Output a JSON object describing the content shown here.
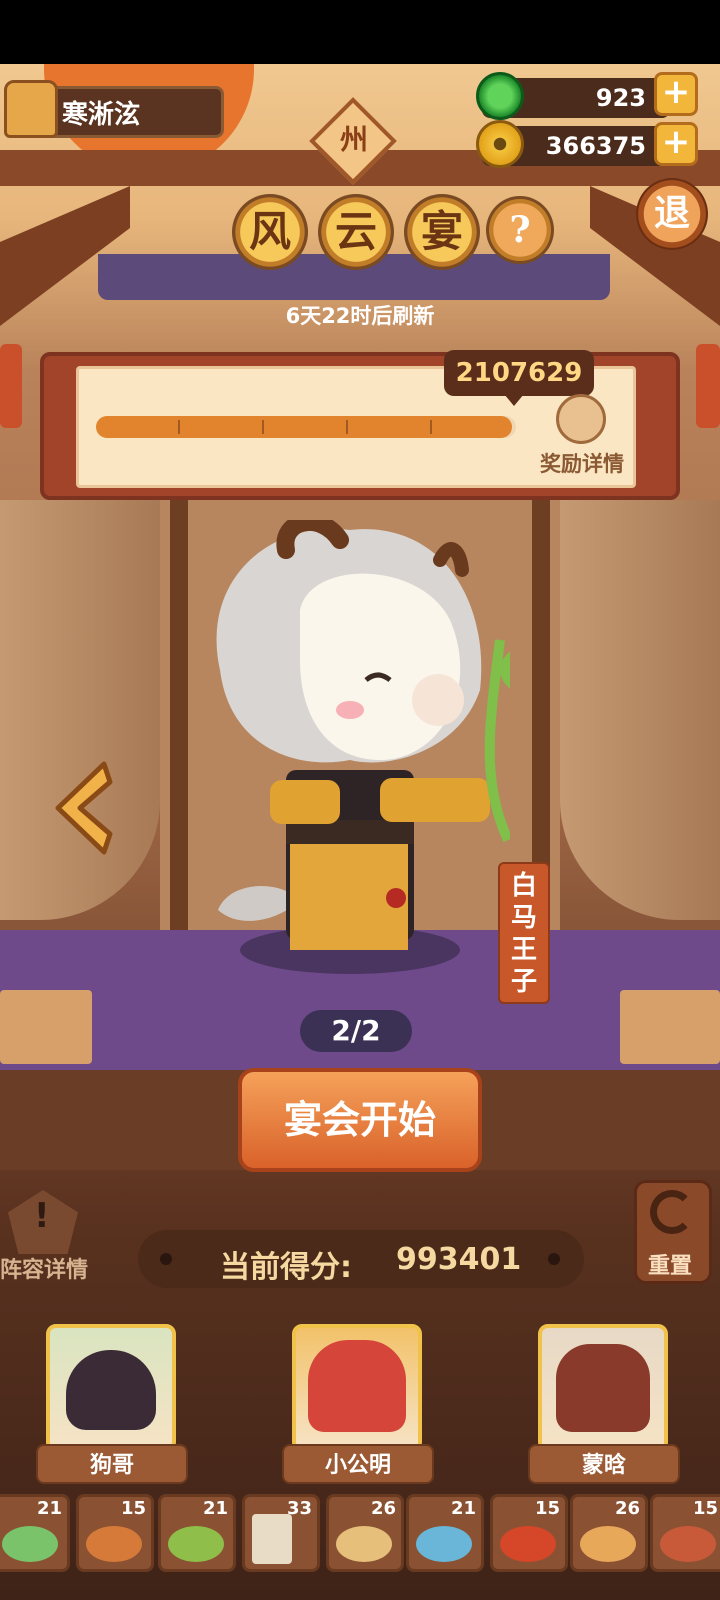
{
  "player": {
    "name": "寒淅泫"
  },
  "currency": {
    "jade": {
      "value": "923",
      "icon": "jade-coin-icon"
    },
    "gold": {
      "value": "366375",
      "icon": "copper-coin-icon"
    }
  },
  "header": {
    "region_badge": "州",
    "title_chars": [
      "风",
      "云",
      "宴"
    ],
    "help_label": "?",
    "retreat_label": "退",
    "refresh_text": "6天22时后刷新"
  },
  "progress": {
    "target_score": "2107629",
    "fill_fraction": 0.99,
    "reward_label": "奖励详情"
  },
  "character": {
    "name": "白马王子",
    "page": "2/2"
  },
  "actions": {
    "start_label": "宴会开始",
    "lineup_label": "阵容详情",
    "reset_label": "重置"
  },
  "score": {
    "label": "当前得分:",
    "value": "993401"
  },
  "heroes": [
    {
      "name": "狗哥"
    },
    {
      "name": "小公明"
    },
    {
      "name": "蒙晗"
    }
  ],
  "dishes": [
    {
      "count": "21",
      "icon": "green-cake-icon"
    },
    {
      "count": "15",
      "icon": "stew-pot-icon"
    },
    {
      "count": "21",
      "icon": "fish-dish-icon"
    },
    {
      "count": "33",
      "icon": "scroll-recipe-icon"
    },
    {
      "count": "26",
      "icon": "pastry-plate-icon"
    },
    {
      "count": "21",
      "icon": "blue-tower-cake-icon"
    },
    {
      "count": "15",
      "icon": "red-soup-icon"
    },
    {
      "count": "26",
      "icon": "platter-icon"
    },
    {
      "count": "15",
      "icon": "hotpot-icon"
    }
  ],
  "colors": {
    "accent_orange": "#e2842d",
    "banner_red": "#a1442a",
    "gold_border": "#f0c24a",
    "floor_purple": "#6e4a8a"
  }
}
